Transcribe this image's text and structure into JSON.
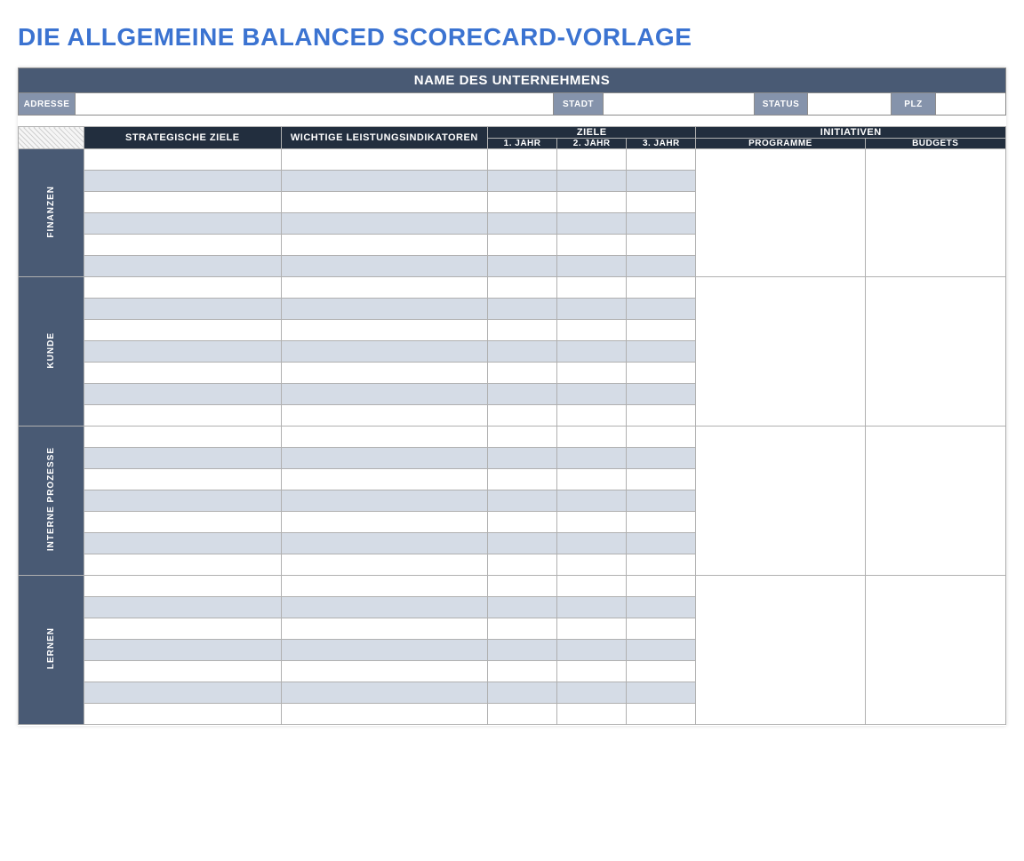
{
  "title": "DIE ALLGEMEINE BALANCED SCORECARD-VORLAGE",
  "company": {
    "name_header": "NAME DES UNTERNEHMENS",
    "address_label": "ADRESSE",
    "city_label": "STADT",
    "status_label": "STATUS",
    "zip_label": "PLZ",
    "address": "",
    "city": "",
    "status": "",
    "zip": ""
  },
  "headers": {
    "objectives": "STRATEGISCHE ZIELE",
    "kpi": "WICHTIGE LEISTUNGSINDIKATOREN",
    "targets": "ZIELE",
    "initiatives": "INITIATIVEN",
    "yr1": "1. JAHR",
    "yr2": "2. JAHR",
    "yr3": "3. JAHR",
    "programs": "PROGRAMME",
    "budgets": "BUDGETS"
  },
  "sections": {
    "finance": "FINANZEN",
    "customer": "KUNDE",
    "internal": "INTERNE PROZESSE",
    "learn": "LERNEN"
  }
}
